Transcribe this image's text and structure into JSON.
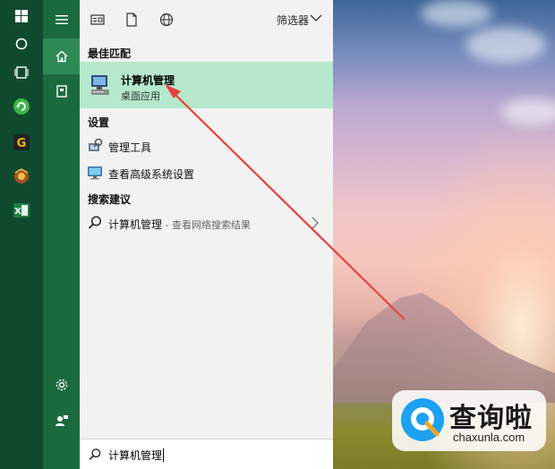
{
  "panel": {
    "filter_label": "筛选器"
  },
  "best_match": {
    "heading": "最佳匹配",
    "title": "计算机管理",
    "subtitle": "桌面应用"
  },
  "settings": {
    "heading": "设置",
    "items": [
      {
        "label": "管理工具",
        "icon": "admin-tools-icon"
      },
      {
        "label": "查看高级系统设置",
        "icon": "monitor-icon"
      }
    ]
  },
  "suggestions": {
    "heading": "搜索建议",
    "items": [
      {
        "label": "计算机管理",
        "suffix": " - 查看网络搜索结果",
        "icon": "search-icon"
      }
    ]
  },
  "search": {
    "value": "计算机管理"
  },
  "watermark": {
    "main": "查询啦",
    "sub": "chaxunla.com"
  },
  "colors": {
    "taskbar": "#0f4a2f",
    "rail": "#1b6a3e",
    "highlight": "#b5e8cd",
    "annotation": "#e8413b"
  }
}
